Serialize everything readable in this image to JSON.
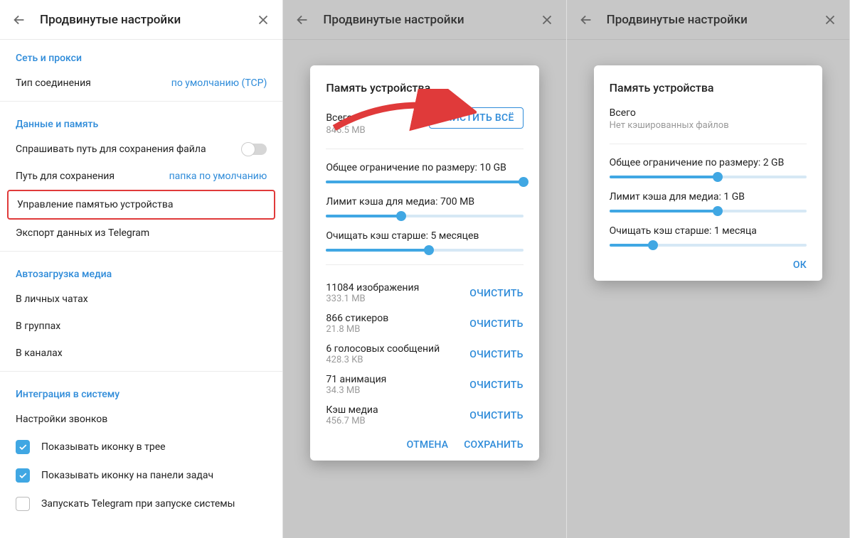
{
  "header_title": "Продвинутые настройки",
  "sections": {
    "network": {
      "title": "Сеть и прокси",
      "conn_type_label": "Тип соединения",
      "conn_type_value": "по умолчанию (TCP)"
    },
    "data": {
      "title": "Данные и память",
      "ask_path_label": "Спрашивать путь для сохранения файла",
      "save_path_label": "Путь для сохранения",
      "save_path_value": "папка по умолчанию",
      "storage_label": "Управление памятью устройства",
      "export_label": "Экспорт данных из Telegram"
    },
    "autoload": {
      "title": "Автозагрузка медиа",
      "private": "В личных чатах",
      "groups": "В группах",
      "channels": "В каналах"
    },
    "system": {
      "title": "Интеграция в систему",
      "calls_label": "Настройки звонков",
      "tray_label": "Показывать иконку в трее",
      "taskbar_label": "Показывать иконку на панели задач",
      "autostart_label": "Запускать Telegram при запуске системы"
    }
  },
  "dialog1": {
    "title": "Память устройства",
    "total_label": "Всего",
    "total_value": "846.5 MB",
    "clear_all": "ОЧИСТИТЬ ВСЁ",
    "size_limit": "Общее ограничение по размеру: 10 GB",
    "media_limit": "Лимит кэша для медиа: 700 MB",
    "age_limit": "Очищать кэш старше: 5 месяцев",
    "clear": "ОЧИСТИТЬ",
    "items": [
      {
        "name": "11084 изображения",
        "size": "333.1 MB"
      },
      {
        "name": "866 стикеров",
        "size": "21.8 MB"
      },
      {
        "name": "6 голосовых сообщений",
        "size": "428.3 KB"
      },
      {
        "name": "71 анимация",
        "size": "34.3 MB"
      },
      {
        "name": "Кэш медиа",
        "size": "456.7 MB"
      }
    ],
    "cancel": "ОТМЕНА",
    "save": "СОХРАНИТЬ"
  },
  "dialog2": {
    "title": "Память устройства",
    "total_label": "Всего",
    "total_value": "Нет кэшированных файлов",
    "size_limit": "Общее ограничение по размеру: 2 GB",
    "media_limit": "Лимит кэша для медиа: 1 GB",
    "age_limit": "Очищать кэш старше: 1 месяца",
    "ok": "ОК"
  },
  "sliders": {
    "d1": {
      "size": 100,
      "media": 38,
      "age": 52
    },
    "d2": {
      "size": 55,
      "media": 55,
      "age": 22
    }
  }
}
